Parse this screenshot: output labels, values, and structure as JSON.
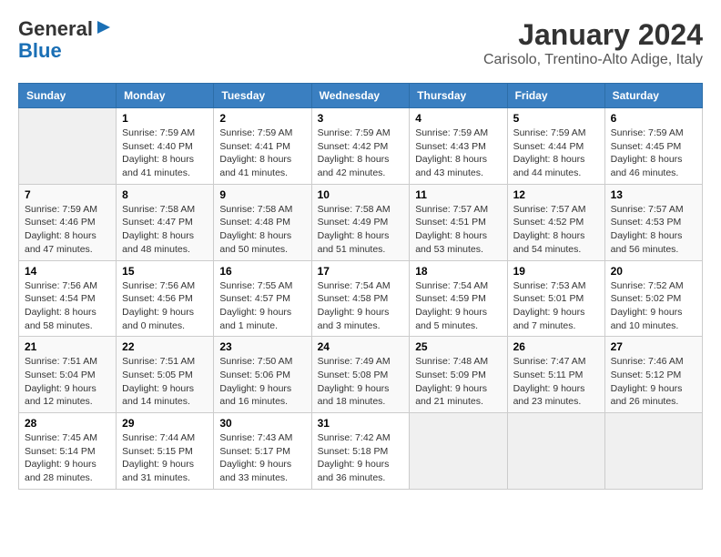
{
  "logo": {
    "line1": "General",
    "line2": "Blue",
    "arrow": "▶"
  },
  "title": "January 2024",
  "location": "Carisolo, Trentino-Alto Adige, Italy",
  "headers": [
    "Sunday",
    "Monday",
    "Tuesday",
    "Wednesday",
    "Thursday",
    "Friday",
    "Saturday"
  ],
  "weeks": [
    [
      {
        "day": "",
        "info": ""
      },
      {
        "day": "1",
        "info": "Sunrise: 7:59 AM\nSunset: 4:40 PM\nDaylight: 8 hours\nand 41 minutes."
      },
      {
        "day": "2",
        "info": "Sunrise: 7:59 AM\nSunset: 4:41 PM\nDaylight: 8 hours\nand 41 minutes."
      },
      {
        "day": "3",
        "info": "Sunrise: 7:59 AM\nSunset: 4:42 PM\nDaylight: 8 hours\nand 42 minutes."
      },
      {
        "day": "4",
        "info": "Sunrise: 7:59 AM\nSunset: 4:43 PM\nDaylight: 8 hours\nand 43 minutes."
      },
      {
        "day": "5",
        "info": "Sunrise: 7:59 AM\nSunset: 4:44 PM\nDaylight: 8 hours\nand 44 minutes."
      },
      {
        "day": "6",
        "info": "Sunrise: 7:59 AM\nSunset: 4:45 PM\nDaylight: 8 hours\nand 46 minutes."
      }
    ],
    [
      {
        "day": "7",
        "info": "Sunrise: 7:59 AM\nSunset: 4:46 PM\nDaylight: 8 hours\nand 47 minutes."
      },
      {
        "day": "8",
        "info": "Sunrise: 7:58 AM\nSunset: 4:47 PM\nDaylight: 8 hours\nand 48 minutes."
      },
      {
        "day": "9",
        "info": "Sunrise: 7:58 AM\nSunset: 4:48 PM\nDaylight: 8 hours\nand 50 minutes."
      },
      {
        "day": "10",
        "info": "Sunrise: 7:58 AM\nSunset: 4:49 PM\nDaylight: 8 hours\nand 51 minutes."
      },
      {
        "day": "11",
        "info": "Sunrise: 7:57 AM\nSunset: 4:51 PM\nDaylight: 8 hours\nand 53 minutes."
      },
      {
        "day": "12",
        "info": "Sunrise: 7:57 AM\nSunset: 4:52 PM\nDaylight: 8 hours\nand 54 minutes."
      },
      {
        "day": "13",
        "info": "Sunrise: 7:57 AM\nSunset: 4:53 PM\nDaylight: 8 hours\nand 56 minutes."
      }
    ],
    [
      {
        "day": "14",
        "info": "Sunrise: 7:56 AM\nSunset: 4:54 PM\nDaylight: 8 hours\nand 58 minutes."
      },
      {
        "day": "15",
        "info": "Sunrise: 7:56 AM\nSunset: 4:56 PM\nDaylight: 9 hours\nand 0 minutes."
      },
      {
        "day": "16",
        "info": "Sunrise: 7:55 AM\nSunset: 4:57 PM\nDaylight: 9 hours\nand 1 minute."
      },
      {
        "day": "17",
        "info": "Sunrise: 7:54 AM\nSunset: 4:58 PM\nDaylight: 9 hours\nand 3 minutes."
      },
      {
        "day": "18",
        "info": "Sunrise: 7:54 AM\nSunset: 4:59 PM\nDaylight: 9 hours\nand 5 minutes."
      },
      {
        "day": "19",
        "info": "Sunrise: 7:53 AM\nSunset: 5:01 PM\nDaylight: 9 hours\nand 7 minutes."
      },
      {
        "day": "20",
        "info": "Sunrise: 7:52 AM\nSunset: 5:02 PM\nDaylight: 9 hours\nand 10 minutes."
      }
    ],
    [
      {
        "day": "21",
        "info": "Sunrise: 7:51 AM\nSunset: 5:04 PM\nDaylight: 9 hours\nand 12 minutes."
      },
      {
        "day": "22",
        "info": "Sunrise: 7:51 AM\nSunset: 5:05 PM\nDaylight: 9 hours\nand 14 minutes."
      },
      {
        "day": "23",
        "info": "Sunrise: 7:50 AM\nSunset: 5:06 PM\nDaylight: 9 hours\nand 16 minutes."
      },
      {
        "day": "24",
        "info": "Sunrise: 7:49 AM\nSunset: 5:08 PM\nDaylight: 9 hours\nand 18 minutes."
      },
      {
        "day": "25",
        "info": "Sunrise: 7:48 AM\nSunset: 5:09 PM\nDaylight: 9 hours\nand 21 minutes."
      },
      {
        "day": "26",
        "info": "Sunrise: 7:47 AM\nSunset: 5:11 PM\nDaylight: 9 hours\nand 23 minutes."
      },
      {
        "day": "27",
        "info": "Sunrise: 7:46 AM\nSunset: 5:12 PM\nDaylight: 9 hours\nand 26 minutes."
      }
    ],
    [
      {
        "day": "28",
        "info": "Sunrise: 7:45 AM\nSunset: 5:14 PM\nDaylight: 9 hours\nand 28 minutes."
      },
      {
        "day": "29",
        "info": "Sunrise: 7:44 AM\nSunset: 5:15 PM\nDaylight: 9 hours\nand 31 minutes."
      },
      {
        "day": "30",
        "info": "Sunrise: 7:43 AM\nSunset: 5:17 PM\nDaylight: 9 hours\nand 33 minutes."
      },
      {
        "day": "31",
        "info": "Sunrise: 7:42 AM\nSunset: 5:18 PM\nDaylight: 9 hours\nand 36 minutes."
      },
      {
        "day": "",
        "info": ""
      },
      {
        "day": "",
        "info": ""
      },
      {
        "day": "",
        "info": ""
      }
    ]
  ]
}
